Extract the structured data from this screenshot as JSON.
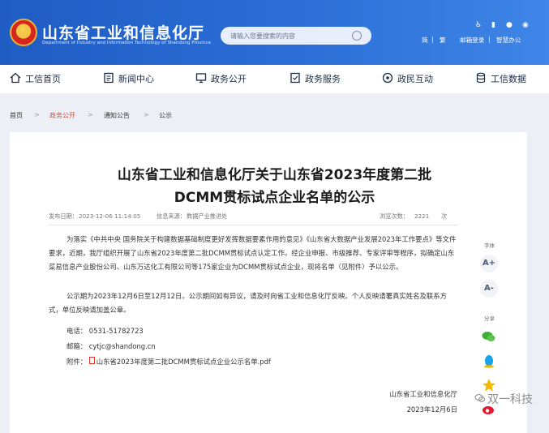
{
  "header": {
    "site_title": "山东省工业和信息化厅",
    "site_subtitle": "Department of Industry and Information Technology of Shandong Province",
    "search_placeholder": "请输入您要搜索的内容",
    "links": {
      "simplified": "简",
      "divider": "|",
      "traditional": "繁",
      "mail_login": "邮箱登录",
      "smart_office": "智慧办公"
    }
  },
  "nav": {
    "items": [
      {
        "label": "工信首页"
      },
      {
        "label": "新闻中心"
      },
      {
        "label": "政务公开"
      },
      {
        "label": "政务服务"
      },
      {
        "label": "政民互动"
      },
      {
        "label": "工信数据"
      }
    ]
  },
  "breadcrumb": {
    "home": "首页",
    "sep": ">",
    "public": "政务公开",
    "notices": "通知公告",
    "current": "公示"
  },
  "article": {
    "title_line1": "山东省工业和信息化厅关于山东省2023年度第二批",
    "title_line2": "DCMM贯标试点企业名单的公示",
    "meta": {
      "date_label": "发布日期：",
      "date": "2023-12-06 11:14:05",
      "source_label": "信息来源：",
      "source": "数据产业推进处",
      "views_label": "浏览次数：",
      "views": "2221",
      "views_unit": "次"
    },
    "para1": "为落实《中共中央 国务院关于构建数据基础制度更好发挥数据要素作用的意见》《山东省大数据产业发展2023年工作要点》等文件要求，近期，我厅组织开展了山东省2023年度第二批DCMM贯标试点认定工作。经企业申报、市级推荐、专家评审等程序，拟确定山东菜易信息产业股份公司、山东万达化工有限公司等175家企业为DCMM贯标试点企业，现将名单（见附件）予以公示。",
    "para2": "公示期为2023年12月6日至12月12日。公示期间如有异议，请及时向省工业和信息化厅反映。个人反映请署真实姓名及联系方式，单位反映请加盖公章。",
    "phone": "电话：  0531-51782723",
    "email": "邮箱：  cytjc@shandong.cn",
    "attachment_label": "附件：",
    "attachment_name": "山东省2023年度第二批DCMM贯标试点企业公示名单.pdf",
    "signature_org": "山东省工业和信息化厅",
    "signature_date": "2023年12月6日"
  },
  "side": {
    "font_label": "字体",
    "font_increase": "A+",
    "font_decrease": "A-",
    "share_label": "分享"
  },
  "watermark": {
    "text": "双一科技"
  },
  "colors": {
    "header_blue": "#2b6fd6",
    "breadcrumb_active": "#d64a3a",
    "wechat_green": "#3cb034",
    "qq_blue": "#1aa3e8",
    "qzone_yellow": "#f5b800",
    "weibo_red": "#e6162d"
  }
}
